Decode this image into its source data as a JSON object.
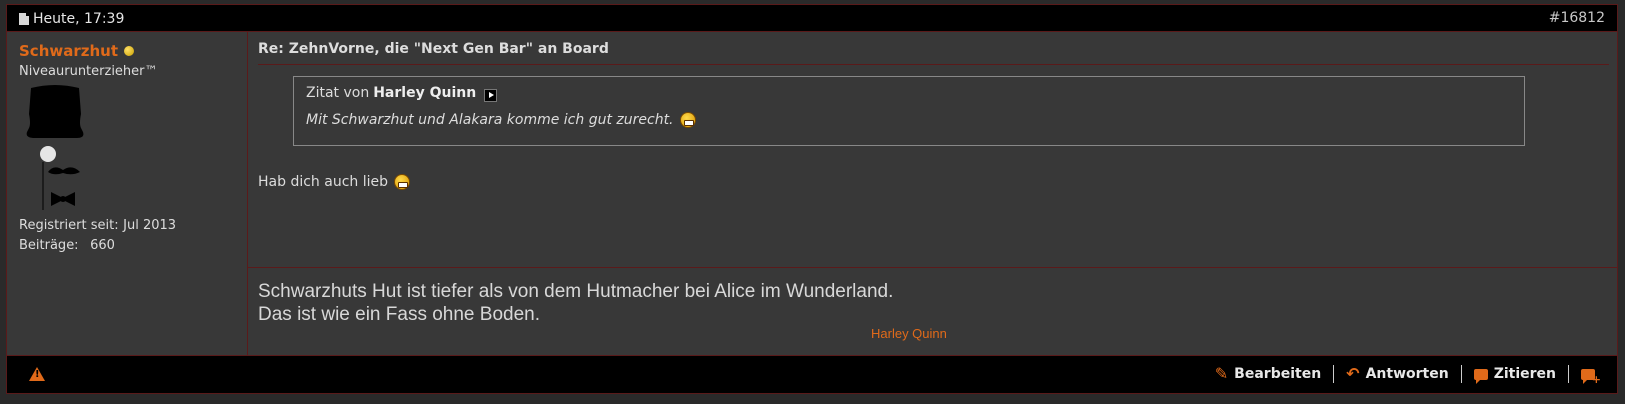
{
  "header": {
    "date": "Heute, 17:39",
    "post_number": "#16812"
  },
  "user": {
    "name": "Schwarzhut",
    "title": "Niveaurunterzieher™",
    "registered_label": "Registriert seit:",
    "registered_value": "Jul 2013",
    "posts_label": "Beiträge:",
    "posts_value": "660"
  },
  "post": {
    "title": "Re: ZehnVorne, die \"Next Gen Bar\" an Board",
    "quote_prefix": "Zitat von",
    "quote_author": "Harley Quinn",
    "quote_text": "Mit Schwarzhut und Alakara komme ich gut zurecht.",
    "message": "Hab dich auch lieb"
  },
  "signature": {
    "line1": "Schwarzhuts Hut ist tiefer als von dem Hutmacher bei Alice im Wunderland.",
    "line2": "Das ist wie ein Fass ohne Boden.",
    "author": "Harley Quinn"
  },
  "footer": {
    "edit_label": "Bearbeiten",
    "reply_label": "Antworten",
    "quote_label": "Zitieren"
  },
  "colors": {
    "accent": "#e06a1a",
    "border": "#5a1a1a",
    "panel": "#383838"
  }
}
